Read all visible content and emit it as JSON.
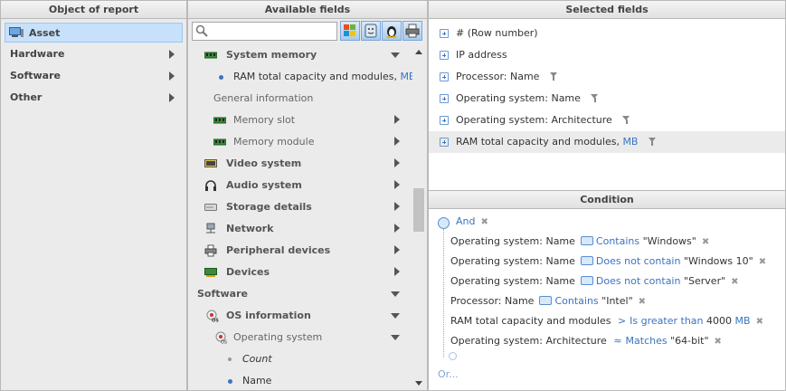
{
  "left": {
    "title": "Object of report",
    "items": [
      {
        "label": "Asset",
        "active": true
      },
      {
        "label": "Hardware"
      },
      {
        "label": "Software"
      },
      {
        "label": "Other"
      }
    ]
  },
  "middle": {
    "title": "Available fields",
    "search": {
      "value": "",
      "placeholder": ""
    },
    "os_buttons": [
      "windows-icon",
      "mac-icon",
      "linux-icon",
      "printer-icon"
    ],
    "fields": [
      {
        "label": "System memory",
        "icon": "memory-icon",
        "expanded": true
      },
      {
        "label": "RAM total capacity and modules, ",
        "unit": "MB"
      },
      {
        "label": "General information"
      },
      {
        "label": "Memory slot",
        "icon": "memory-icon"
      },
      {
        "label": "Memory module",
        "icon": "memory-icon"
      },
      {
        "label": "Video system",
        "icon": "monitor-icon"
      },
      {
        "label": "Audio system",
        "icon": "headphones-icon"
      },
      {
        "label": "Storage details",
        "icon": "disk-icon"
      },
      {
        "label": "Network",
        "icon": "network-icon"
      },
      {
        "label": "Peripheral devices",
        "icon": "printer-icon"
      },
      {
        "label": "Devices",
        "icon": "card-icon"
      },
      {
        "label": "Software",
        "expanded": true
      },
      {
        "label": "OS information",
        "icon": "os-icon",
        "expanded": true
      },
      {
        "label": "Operating system",
        "icon": "os-icon",
        "expanded": true
      },
      {
        "label": "Count"
      },
      {
        "label": "Name"
      }
    ]
  },
  "selected": {
    "title": "Selected fields",
    "rows": [
      {
        "label": "# (Row number)"
      },
      {
        "label": "IP address"
      },
      {
        "label": "Processor: Name",
        "filter": true
      },
      {
        "label": "Operating system: Name",
        "filter": true
      },
      {
        "label": "Operating system: Architecture",
        "filter": true
      },
      {
        "label": "RAM total capacity and modules, ",
        "unit": "MB",
        "filter": true,
        "highlight": true
      }
    ]
  },
  "condition": {
    "title": "Condition",
    "group": "And",
    "or_link": "Or...",
    "rows": [
      {
        "field": "Operating system: Name",
        "op": "Contains",
        "value": "\"Windows\""
      },
      {
        "field": "Operating system: Name",
        "op": "Does not contain",
        "value": "\"Windows 10\""
      },
      {
        "field": "Operating system: Name",
        "op": "Does not contain",
        "value": "\"Server\""
      },
      {
        "field": "Processor: Name",
        "op": "Contains",
        "value": "\"Intel\""
      },
      {
        "field": "RAM total capacity and modules",
        "op_symbol": ">",
        "op": "Is greater than",
        "value": "4000",
        "unit": "MB"
      },
      {
        "field": "Operating system: Architecture",
        "op_symbol": "≈",
        "op": "Matches",
        "value": "\"64-bit\""
      }
    ],
    "remove_symbol": "✖",
    "accent": "#3b74c0"
  }
}
